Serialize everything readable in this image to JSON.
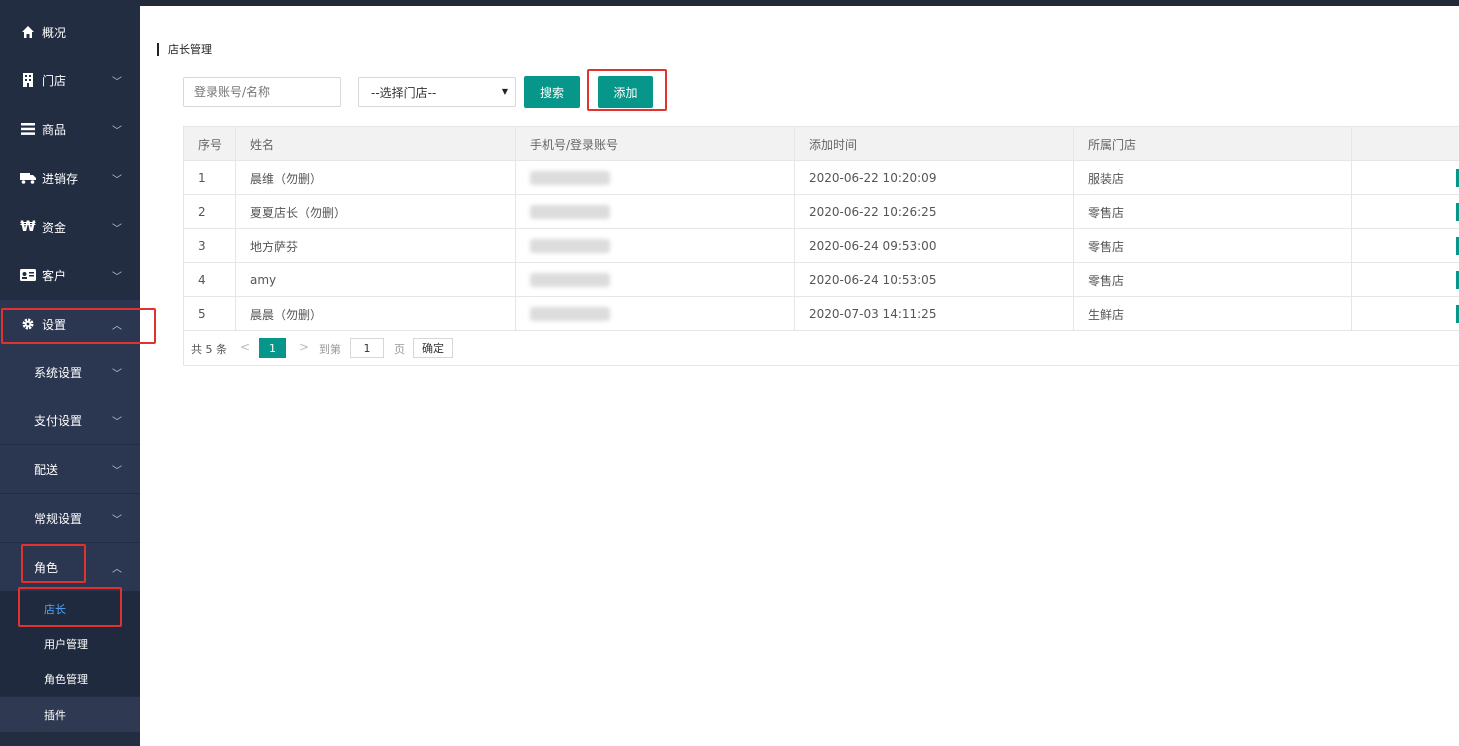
{
  "sidebar": {
    "items": [
      {
        "label": "概况",
        "icon": "home-icon"
      },
      {
        "label": "门店",
        "icon": "building-icon"
      },
      {
        "label": "商品",
        "icon": "list-icon"
      },
      {
        "label": "进销存",
        "icon": "truck-icon"
      },
      {
        "label": "资金",
        "icon": "currency-icon"
      },
      {
        "label": "客户",
        "icon": "id-card-icon"
      },
      {
        "label": "设置",
        "icon": "gear-icon"
      }
    ],
    "settings_sub": [
      "系统设置",
      "支付设置",
      "配送",
      "常规设置",
      "角色"
    ],
    "role_children": [
      "店长",
      "用户管理",
      "角色管理"
    ],
    "plugin": "插件"
  },
  "main": {
    "page_title": "店长管理",
    "search_placeholder": "登录账号/名称",
    "store_select": "--选择门店--",
    "search_button": "搜索",
    "add_button": "添加"
  },
  "table": {
    "headers": [
      "序号",
      "姓名",
      "手机号/登录账号",
      "添加时间",
      "所属门店",
      ""
    ],
    "rows": [
      {
        "no": "1",
        "name": "晨维（勿删）",
        "time": "2020-06-22 10:20:09",
        "store": "服装店"
      },
      {
        "no": "2",
        "name": "夏夏店长（勿删）",
        "time": "2020-06-22 10:26:25",
        "store": "零售店"
      },
      {
        "no": "3",
        "name": "地方萨芬",
        "time": "2020-06-24 09:53:00",
        "store": "零售店"
      },
      {
        "no": "4",
        "name": "amy",
        "time": "2020-06-24 10:53:05",
        "store": "零售店"
      },
      {
        "no": "5",
        "name": "晨晨（勿删）",
        "time": "2020-07-03 14:11:25",
        "store": "生鲜店"
      }
    ]
  },
  "pager": {
    "total": "共 5 条",
    "current": "1",
    "goto": "到第",
    "page_value": "1",
    "page_unit": "页",
    "confirm": "确定"
  },
  "colors": {
    "accent": "#06968a",
    "sidebar": "#222d42",
    "highlight": "#e0332f",
    "active_link": "#4ea7ff"
  }
}
